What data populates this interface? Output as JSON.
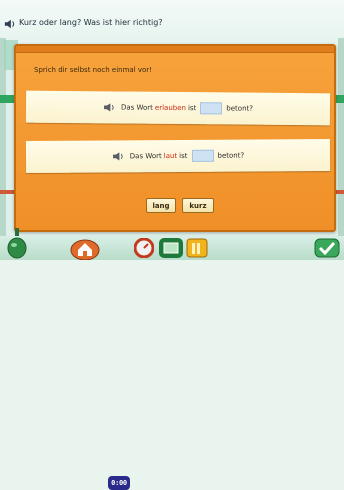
{
  "header": {
    "title": "Kurz oder lang? Was ist hier richtig?",
    "speaker_icon": "speaker-icon"
  },
  "dialog": {
    "instruction": "Sprich dir selbst noch einmal vor!",
    "sentences": [
      {
        "prefix": "Das Wort",
        "word": "erlauben",
        "middle": "ist",
        "suffix": "betont?"
      },
      {
        "prefix": "Das Wort",
        "word": "laut",
        "middle": "ist",
        "suffix": "betont?"
      }
    ],
    "buttons": {
      "lang": "lang",
      "kurz": "kurz"
    }
  },
  "toolbar": {
    "clock": "0:00",
    "icons": [
      "potion-icon",
      "home-icon",
      "clock-icon",
      "gauge-icon",
      "stack-icon",
      "folder-icon",
      "check-icon"
    ]
  },
  "colors": {
    "dialog": "#f39a31",
    "strip": "#fdf6d8",
    "highlight_word": "#cc2b14",
    "gap": "#cfe2f3"
  }
}
